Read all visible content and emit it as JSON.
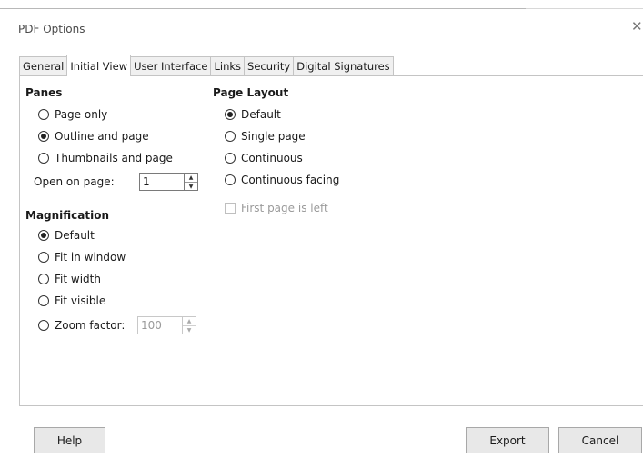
{
  "window": {
    "title": "PDF Options"
  },
  "tabs": [
    "General",
    "Initial View",
    "User Interface",
    "Links",
    "Security",
    "Digital Signatures"
  ],
  "panes": {
    "heading": "Panes",
    "options": [
      {
        "label": "Page only",
        "checked": false
      },
      {
        "label": "Outline and page",
        "checked": true
      },
      {
        "label": "Thumbnails and page",
        "checked": false
      }
    ],
    "open_on_page_label": "Open on page:",
    "open_on_page_value": "1"
  },
  "magnification": {
    "heading": "Magnification",
    "options": [
      {
        "label": "Default",
        "checked": true
      },
      {
        "label": "Fit in window",
        "checked": false
      },
      {
        "label": "Fit width",
        "checked": false
      },
      {
        "label": "Fit visible",
        "checked": false
      },
      {
        "label": "Zoom factor:",
        "checked": false
      }
    ],
    "zoom_value": "100"
  },
  "page_layout": {
    "heading": "Page Layout",
    "options": [
      {
        "label": "Default",
        "checked": true
      },
      {
        "label": "Single page",
        "checked": false
      },
      {
        "label": "Continuous",
        "checked": false
      },
      {
        "label": "Continuous facing",
        "checked": false
      }
    ],
    "first_page_left": {
      "label": "First page is left",
      "checked": false,
      "enabled": false
    }
  },
  "buttons": {
    "help": "Help",
    "export": "Export",
    "cancel": "Cancel"
  }
}
